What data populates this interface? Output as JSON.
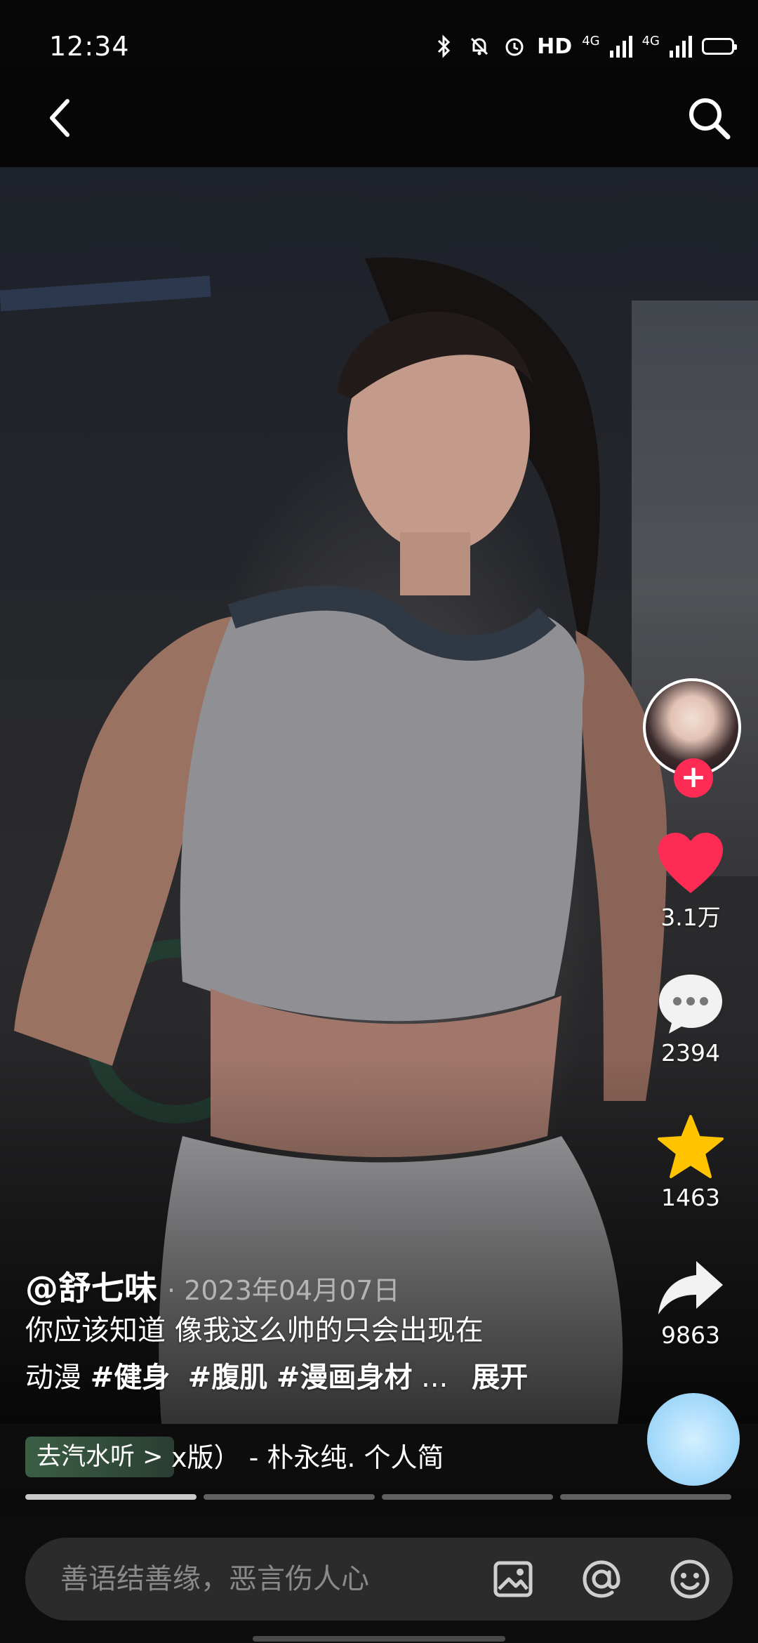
{
  "status_bar": {
    "time": "12:34",
    "hd": "HD",
    "network_1": "4G",
    "network_2": "4G"
  },
  "nav": {
    "back_icon": "chevron-left-icon",
    "search_icon": "search-icon"
  },
  "actions": {
    "follow_plus": "+",
    "like_count": "3.1万",
    "comment_count": "2394",
    "collect_count": "1463",
    "share_count": "9863"
  },
  "caption": {
    "author": "@舒七味",
    "date": "· 2023年04月07日",
    "desc_line1": "你应该知道 像我这么帅的只会出现在",
    "desc_line2_prefix": "动漫 ",
    "hashtags": [
      "#健身",
      "#腹肌",
      "#漫画身材"
    ],
    "ellipsis": "...",
    "expand": "展开"
  },
  "music": {
    "link_label": "去汽水听 >",
    "title": "x版）  - 朴永纯.    个人简"
  },
  "progress": {
    "segments": 4,
    "completed": 0
  },
  "comment_bar": {
    "placeholder": "善语结善缘，恶言伤人心"
  },
  "colors": {
    "like": "#fe2c55",
    "collect": "#ffc300",
    "follow": "#fe2c55",
    "music_link": "#3b5e45"
  }
}
